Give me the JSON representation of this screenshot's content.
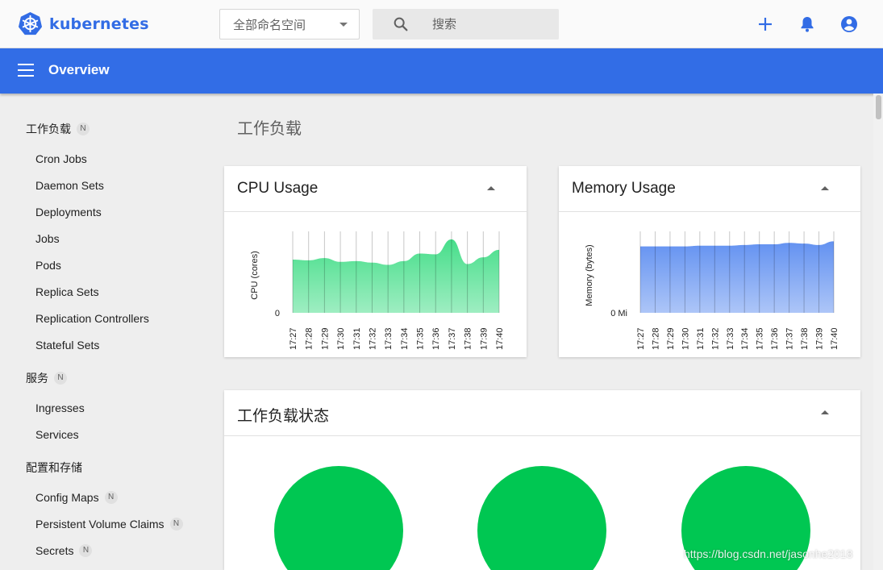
{
  "brand": {
    "name": "kubernetes",
    "color": "#326ce5"
  },
  "topbar": {
    "namespace_selected": "全部命名空间",
    "search_placeholder": "搜索",
    "icons": [
      "plus-icon",
      "bell-icon",
      "account-circle-icon"
    ]
  },
  "header": {
    "title": "Overview",
    "color": "#326de6"
  },
  "sidebar": {
    "sections": [
      {
        "label": "工作负载",
        "badge": "N",
        "items": [
          {
            "label": "Cron Jobs"
          },
          {
            "label": "Daemon Sets"
          },
          {
            "label": "Deployments"
          },
          {
            "label": "Jobs"
          },
          {
            "label": "Pods"
          },
          {
            "label": "Replica Sets"
          },
          {
            "label": "Replication Controllers"
          },
          {
            "label": "Stateful Sets"
          }
        ]
      },
      {
        "label": "服务",
        "badge": "N",
        "items": [
          {
            "label": "Ingresses"
          },
          {
            "label": "Services"
          }
        ]
      },
      {
        "label": "配置和存储",
        "badge": "",
        "items": [
          {
            "label": "Config Maps",
            "badge": "N"
          },
          {
            "label": "Persistent Volume Claims",
            "badge": "N"
          },
          {
            "label": "Secrets",
            "badge": "N"
          }
        ]
      }
    ]
  },
  "main": {
    "section_title": "工作负载",
    "status_card": {
      "title": "工作负载状态",
      "circle_color": "#00c752"
    }
  },
  "chart_data": [
    {
      "type": "area",
      "title": "CPU Usage",
      "ylabel": "CPU (cores)",
      "y_tick_label": "0",
      "color": "#3ddc84",
      "x": [
        "17:27",
        "17:28",
        "17:29",
        "17:30",
        "17:31",
        "17:32",
        "17:33",
        "17:34",
        "17:35",
        "17:36",
        "17:37",
        "17:38",
        "17:39",
        "17:40"
      ],
      "values": [
        0.71,
        0.7,
        0.73,
        0.68,
        0.69,
        0.67,
        0.64,
        0.69,
        0.79,
        0.78,
        0.98,
        0.65,
        0.74,
        0.84
      ],
      "ylim": [
        0,
        1
      ]
    },
    {
      "type": "area",
      "title": "Memory Usage",
      "ylabel": "Memory (bytes)",
      "y_tick_label": "0 Mi",
      "color": "#5b8cf0",
      "x": [
        "17:27",
        "17:28",
        "17:29",
        "17:30",
        "17:31",
        "17:32",
        "17:33",
        "17:34",
        "17:35",
        "17:36",
        "17:37",
        "17:38",
        "17:39",
        "17:40"
      ],
      "values": [
        0.93,
        0.93,
        0.93,
        0.93,
        0.94,
        0.94,
        0.94,
        0.95,
        0.96,
        0.96,
        0.98,
        0.97,
        0.95,
        1.0
      ],
      "ylim": [
        0,
        1.05
      ]
    }
  ],
  "watermark": "https://blog.csdn.net/jasonhe2018"
}
